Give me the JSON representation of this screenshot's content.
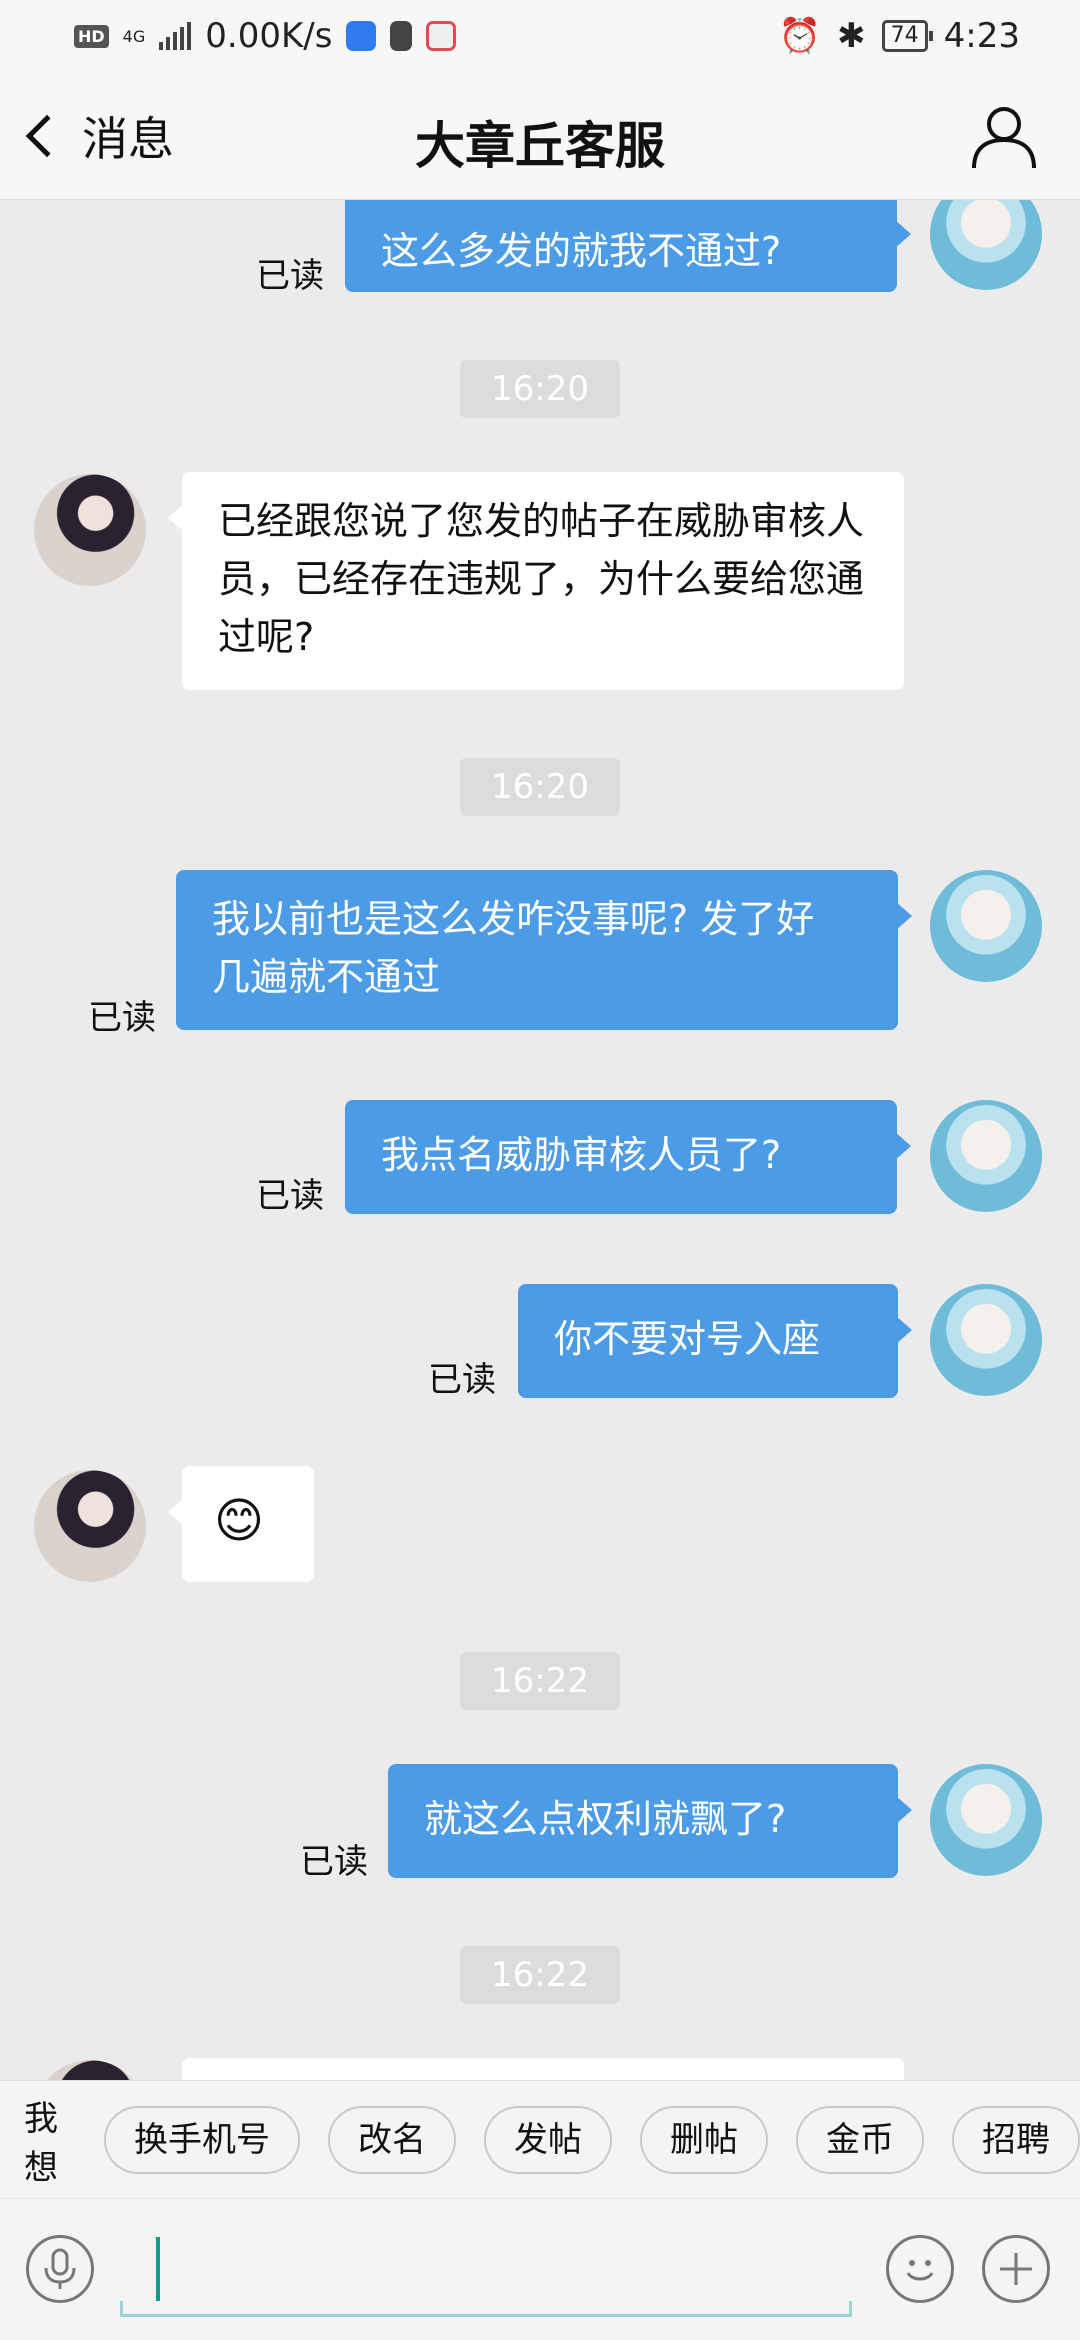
{
  "status": {
    "speed": "0.00K/s",
    "battery": "74",
    "time": "4:23",
    "network": "4G"
  },
  "header": {
    "back_label": "消息",
    "title": "大章丘客服"
  },
  "messages": {
    "m1": {
      "text": "这么多发的就我不通过?",
      "read": "已读"
    },
    "t1": "16:20",
    "m2": {
      "text": "已经跟您说了您发的帖子在威胁审核人员，已经存在违规了，为什么要给您通过呢?"
    },
    "t2": "16:20",
    "m3": {
      "text": "我以前也是这么发咋没事呢? 发了好几遍就不通过",
      "read": "已读"
    },
    "m4": {
      "text": "我点名威胁审核人员了?",
      "read": "已读"
    },
    "m5": {
      "text": "你不要对号入座",
      "read": "已读"
    },
    "m6": {
      "emoji": "😊"
    },
    "t3": "16:22",
    "m7": {
      "text": "就这么点权利就飘了?",
      "read": "已读"
    },
    "t4": "16:22"
  },
  "suggestions": {
    "label": "我想",
    "chips": [
      "换手机号",
      "改名",
      "发帖",
      "删帖",
      "金币",
      "招聘"
    ]
  },
  "colors": {
    "outgoing_bubble": "#4b9be6",
    "background": "#ebebeb",
    "cursor": "#0a9b8a"
  }
}
